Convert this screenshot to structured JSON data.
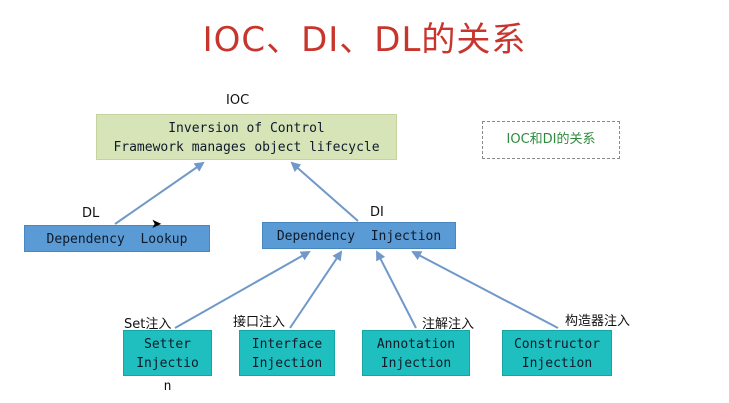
{
  "title": "IOC、DI、DL的关系",
  "ioc": {
    "label": "IOC",
    "line1": "Inversion of Control",
    "line2": "Framework manages object lifecycle"
  },
  "dl": {
    "label": "DL",
    "box": "Dependency  Lookup"
  },
  "di": {
    "label": "DI",
    "box": "Dependency  Injection"
  },
  "injections": [
    {
      "label": "Set注入",
      "line1": "Setter",
      "line2": "Injectio",
      "line3": "n"
    },
    {
      "label": "接口注入",
      "line1": "Interface",
      "line2": "Injection"
    },
    {
      "label": "注解注入",
      "line1": "Annotation",
      "line2": "Injection"
    },
    {
      "label": "构造器注入",
      "line1": "Constructor",
      "line2": "Injection"
    }
  ],
  "legend": "IOC和DI的关系",
  "colors": {
    "title": "#c8352c",
    "ioc_box": "#d6e4b8",
    "mid_box": "#5b9bd5",
    "leaf_box": "#20bfbf",
    "arrow": "#7098c8",
    "legend_text": "#2e8b3d"
  }
}
